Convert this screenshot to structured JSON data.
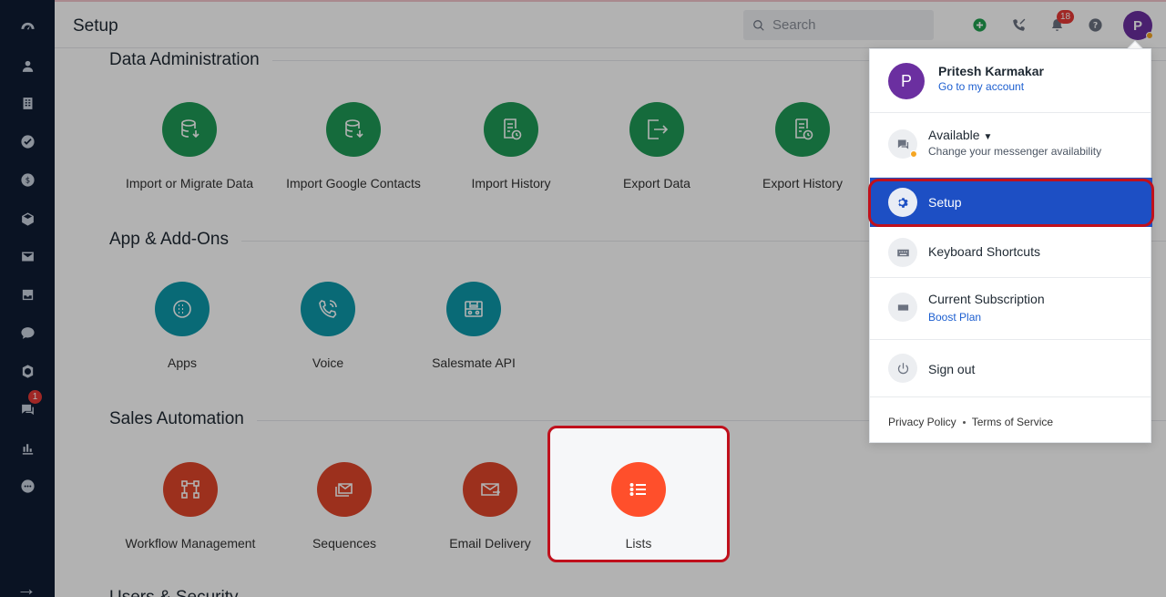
{
  "header": {
    "title": "Setup",
    "search_placeholder": "Search",
    "notifications_count": "18"
  },
  "user": {
    "initial": "P",
    "name": "Pritesh Karmakar",
    "account_link": "Go to my account"
  },
  "rail": {
    "chat_badge": "1"
  },
  "sections": {
    "data_admin": {
      "title": "Data Administration",
      "items": [
        "Import or Migrate Data",
        "Import Google Contacts",
        "Import History",
        "Export Data",
        "Export History"
      ]
    },
    "apps": {
      "title": "App & Add-Ons",
      "items": [
        "Apps",
        "Voice",
        "Salesmate API"
      ]
    },
    "sales_automation": {
      "title": "Sales Automation",
      "items": [
        "Workflow Management",
        "Sequences",
        "Email Delivery",
        "Lists"
      ]
    },
    "cut_title": "Users & Security"
  },
  "dropdown": {
    "availability_label": "Available",
    "availability_sub": "Change your messenger availability",
    "setup": "Setup",
    "shortcuts": "Keyboard Shortcuts",
    "subscription": "Current Subscription",
    "plan": "Boost Plan",
    "signout": "Sign out",
    "privacy": "Privacy Policy",
    "terms": "Terms of Service"
  },
  "colors": {
    "green": "#1f9a57",
    "teal": "#0e99a9",
    "red": "#e0462a",
    "highlight": "#c0101c",
    "setup_blue": "#1d4fc4"
  }
}
